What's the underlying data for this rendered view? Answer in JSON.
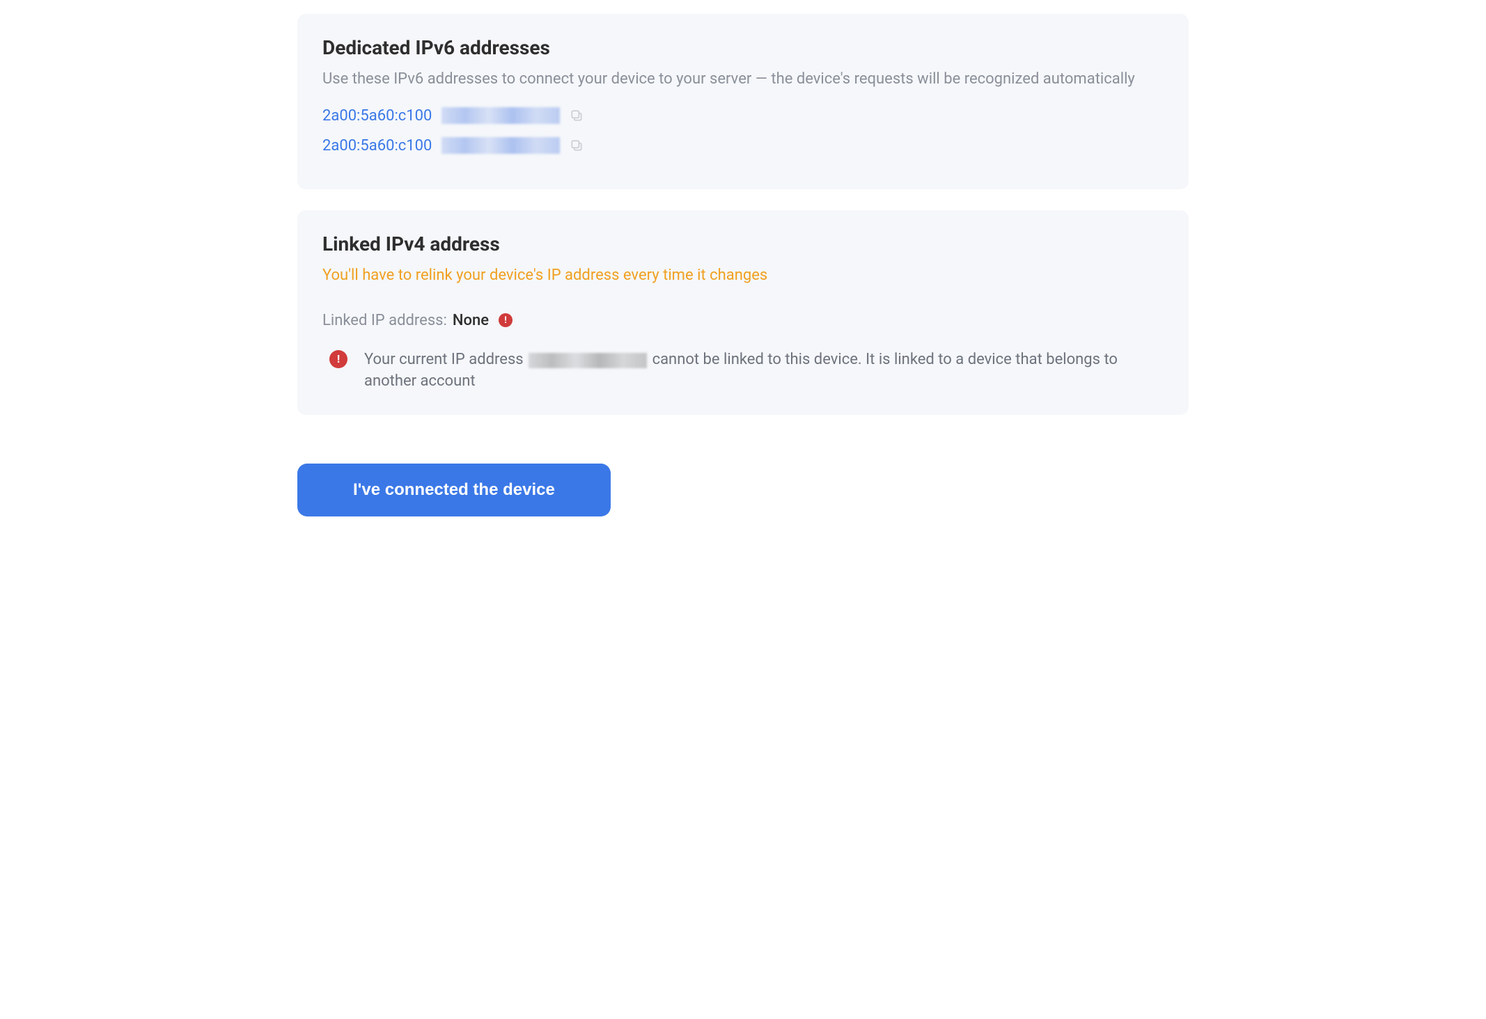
{
  "ipv6_card": {
    "title": "Dedicated IPv6 addresses",
    "subtitle": "Use these IPv6 addresses to connect your device to your server — the device's requests will be recognized automatically",
    "addresses": [
      {
        "prefix": "2a00:5a60:c100",
        "rest_redacted": true
      },
      {
        "prefix": "2a00:5a60:c100",
        "rest_redacted": true
      }
    ]
  },
  "ipv4_card": {
    "title": "Linked IPv4 address",
    "subtitle": "You'll have to relink your device's IP address every time it changes",
    "linked_ip_label": "Linked IP address:",
    "linked_ip_value": "None",
    "warning_prefix": "Your current IP address ",
    "warning_suffix": " cannot be linked to this device. It is linked to a device that belongs to another account",
    "current_ip_redacted": true
  },
  "primary_button_label": "I've connected the device"
}
